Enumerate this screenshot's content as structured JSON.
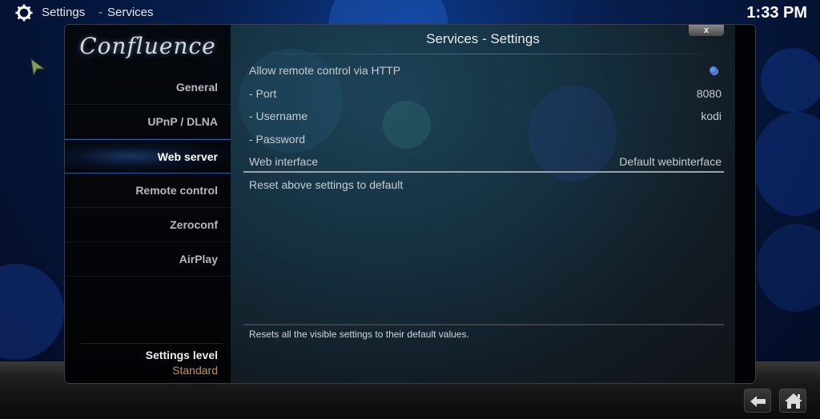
{
  "topbar": {
    "breadcrumb_root": "Settings",
    "breadcrumb_sep": "-",
    "breadcrumb_current": "Services",
    "clock": "1:33 PM"
  },
  "dialog": {
    "title": "Services - Settings",
    "close_label": "x",
    "logo": "Confluence"
  },
  "sidebar": {
    "items": [
      {
        "label": "General",
        "active": false
      },
      {
        "label": "UPnP / DLNA",
        "active": false
      },
      {
        "label": "Web server",
        "active": true
      },
      {
        "label": "Remote control",
        "active": false
      },
      {
        "label": "Zeroconf",
        "active": false
      },
      {
        "label": "AirPlay",
        "active": false
      }
    ],
    "settings_level_label": "Settings level",
    "settings_level_value": "Standard"
  },
  "settings": [
    {
      "label": "Allow remote control via HTTP",
      "value": "",
      "type": "toggle",
      "enabled": true
    },
    {
      "label": "- Port",
      "value": "8080",
      "type": "text"
    },
    {
      "label": "- Username",
      "value": "kodi",
      "type": "text"
    },
    {
      "label": "- Password",
      "value": "",
      "type": "text"
    },
    {
      "label": "Web interface",
      "value": "Default webinterface",
      "type": "select"
    },
    {
      "label": "Reset above settings to default",
      "value": "",
      "type": "action"
    }
  ],
  "description": "Resets all the visible settings to their default values.",
  "footer": {
    "back_icon": "back-arrow-icon",
    "home_icon": "home-icon"
  },
  "colors": {
    "accent_blue": "#2b5aa0",
    "settings_level_value": "#c9915f",
    "toggle_on": "#1a50d0"
  }
}
